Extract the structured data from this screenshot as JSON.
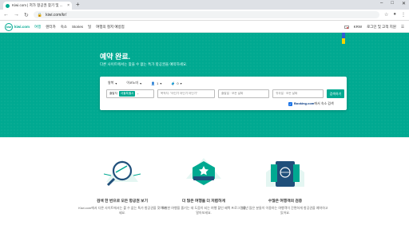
{
  "browser": {
    "tab_title": "Kiwi.com | 저가 항공권 찾기 및 ...",
    "url": "kiwi.com/kr/",
    "new_tab": "+",
    "close": "×"
  },
  "site": {
    "logo_text": "kiwi.com",
    "logo_mark": "kiwi",
    "nav": [
      "여행",
      "렌터카",
      "숙소",
      "Stories",
      "딜",
      "여행의 철저 예방접"
    ],
    "currency": "KRW",
    "account": "로그인 및 고객 지원"
  },
  "hero": {
    "title": "예약 완료.",
    "subtitle": "다른 사이트에서는 찾을 수 없는 특가 항공권을 예약하세요."
  },
  "search": {
    "trip_type": "왕복",
    "cabin": "이코노미",
    "passengers": "1",
    "bags": "0",
    "from_label": "출발지",
    "from_chip": "서울특별시",
    "to_placeholder": "목적지: \"어딘가 어딘가 어딘가\"",
    "depart_placeholder": "출발일 · 모든 날짜",
    "return_placeholder": "귀국일 · 모든 날짜",
    "search_button": "검색하기",
    "booking_brand": "Booking.com",
    "booking_text": "에서 숙소 검색"
  },
  "features": [
    {
      "title": "검색 한 번으로 모든 항공권 보기",
      "desc": "Kiwi.com에서 다른 사이트에서는 볼 수 없는 특가 항공권을 찾아보세요."
    },
    {
      "title": "더 많은 여행을 더 저렴하게",
      "desc": "특별한 여행을 즐기는 데 도움이 되는 여행 할인 혜택 프로그램을 알아보세요."
    },
    {
      "title": "수많은 여행객의 검증",
      "desc": "매년 많은 분들이 이용하는 여행객이 간편하게 항공권을 예약하고 있어요."
    }
  ],
  "colors": {
    "brand": "#00a991",
    "brand_dark": "#007a6a"
  }
}
